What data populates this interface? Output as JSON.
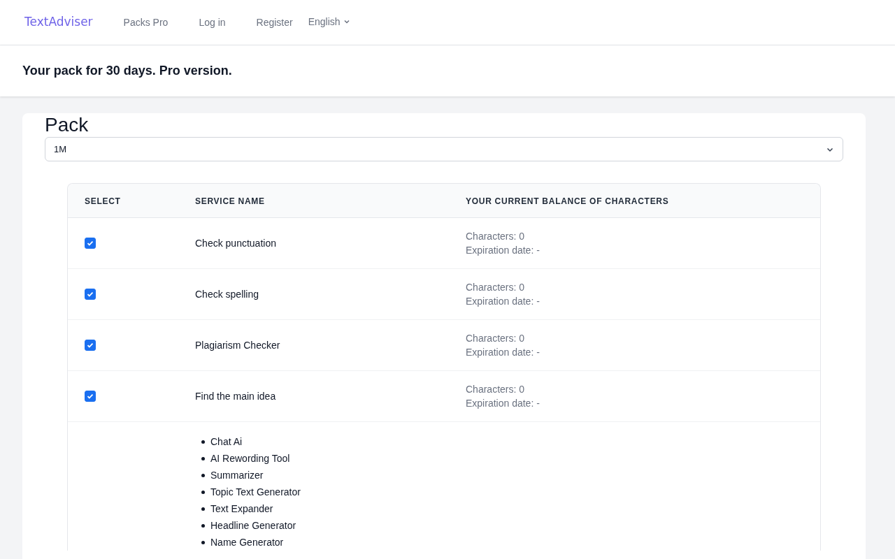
{
  "navbar": {
    "brand": "TextAdviser",
    "links": [
      "Packs Pro",
      "Log in",
      "Register"
    ],
    "language": "English"
  },
  "header": {
    "title": "Your pack for 30 days. Pro version."
  },
  "pack": {
    "label": "Pack",
    "value": "1M"
  },
  "table": {
    "columns": [
      "SELECT",
      "SERVICE NAME",
      "YOUR CURRENT BALANCE OF CHARACTERS"
    ],
    "rows": [
      {
        "checked": true,
        "service": "Check punctuation",
        "characters": "Characters: 0",
        "expiration": "Expiration date: -"
      },
      {
        "checked": true,
        "service": "Check spelling",
        "characters": "Characters: 0",
        "expiration": "Expiration date: -"
      },
      {
        "checked": true,
        "service": "Plagiarism Checker",
        "characters": "Characters: 0",
        "expiration": "Expiration date: -"
      },
      {
        "checked": true,
        "service": "Find the main idea",
        "characters": "Characters: 0",
        "expiration": "Expiration date: -"
      }
    ],
    "included_tools": [
      "Chat Ai",
      "AI Rewording Tool",
      "Summarizer",
      "Topic Text Generator",
      "Text Expander",
      "Headline Generator",
      "Name Generator"
    ]
  }
}
